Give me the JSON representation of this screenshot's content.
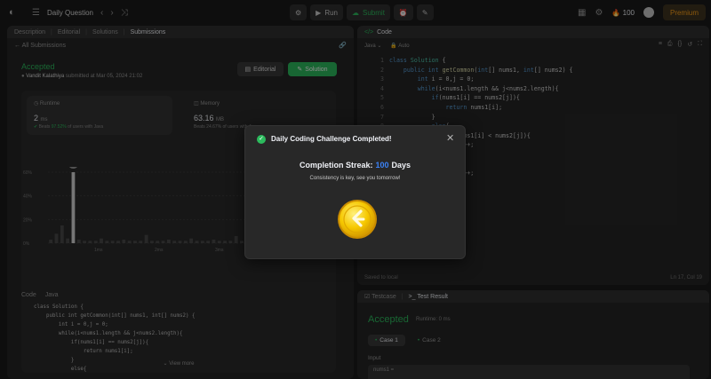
{
  "topbar": {
    "problem_list_label": "Daily Question",
    "run_label": "Run",
    "submit_label": "Submit",
    "streak_count": "100",
    "premium_label": "Premium"
  },
  "left_tabs": [
    "Description",
    "Editorial",
    "Solutions",
    "Submissions"
  ],
  "submission": {
    "back_label": "All Submissions",
    "status": "Accepted",
    "author": "Vandit Kalathiya",
    "submitted_at": "submitted at Mar 05, 2024 21:02",
    "editorial_btn": "Editorial",
    "solution_btn": "Solution",
    "runtime_label": "Runtime",
    "runtime_value": "2",
    "runtime_unit": "ms",
    "runtime_beats_prefix": "Beats",
    "runtime_beats_pct": "97.52%",
    "runtime_beats_suffix": "of users with Java",
    "memory_label": "Memory",
    "memory_value": "63.16",
    "memory_unit": "MB",
    "memory_beats": "Beats 24.67% of users with Java"
  },
  "chart_data": {
    "type": "bar",
    "yticks": [
      "60%",
      "40%",
      "20%",
      "0%"
    ],
    "xticks": [
      "1ms",
      "2ms",
      "3ms",
      "4ms"
    ],
    "values": [
      3,
      8,
      15,
      4,
      80,
      3,
      2,
      2,
      2,
      4,
      2,
      2,
      2,
      3,
      2,
      2,
      2,
      7,
      2,
      2,
      2,
      3,
      2,
      2,
      2,
      4,
      2,
      2,
      2,
      3,
      2,
      2,
      2,
      6,
      2,
      2,
      2,
      2,
      3,
      2,
      2,
      2,
      2,
      2,
      3,
      2,
      2,
      2,
      2,
      2
    ],
    "highlight_index": 4,
    "ylim": [
      0,
      60
    ]
  },
  "submitted_code": {
    "header": [
      "Code",
      "Java"
    ],
    "lines": [
      "class Solution {",
      "    public int getCommon(int[] nums1, int[] nums2) {",
      "        int i = 0,j = 0;",
      "        while(i<nums1.length && j<nums2.length){",
      "            if(nums1[i] == nums2[j]){",
      "                return nums1[i];",
      "            }",
      "            else{"
    ],
    "view_more": "View more"
  },
  "editor": {
    "tab_label": "Code",
    "language": "Java",
    "auto_label": "Auto",
    "line_numbers": [
      "1",
      "2",
      "3",
      "4",
      "5",
      "6",
      "7",
      "8",
      "9",
      "10",
      "11",
      "12",
      "13",
      "14",
      "15",
      "16"
    ],
    "saved_label": "Saved to local",
    "cursor_pos": "Ln 17, Col 19"
  },
  "result": {
    "tabs": [
      "Testcase",
      "Test Result"
    ],
    "status": "Accepted",
    "runtime": "Runtime: 0 ms",
    "cases": [
      "Case 1",
      "Case 2"
    ],
    "input_label": "Input",
    "input_value": "nums1 ="
  },
  "modal": {
    "title": "Daily Coding Challenge Completed!",
    "streak_prefix": "Completion Streak:",
    "streak_num": "100",
    "streak_suffix": "Days",
    "subtitle": "Consistency is key, see you tomorrow!"
  }
}
